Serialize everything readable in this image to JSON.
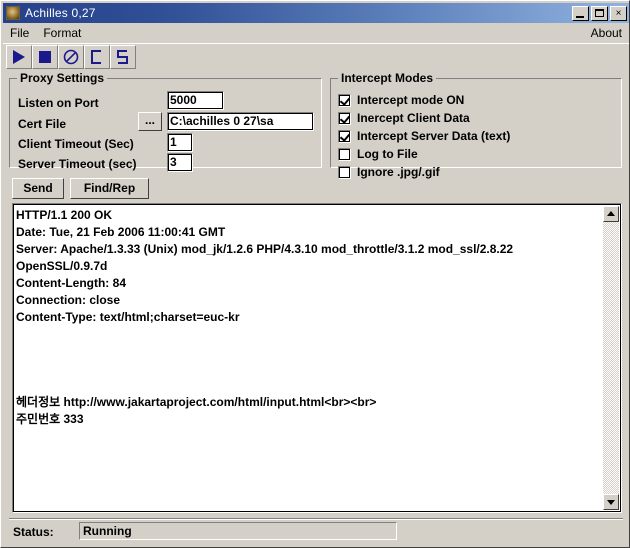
{
  "window": {
    "title": "Achilles 0,27",
    "icon": "achilles-app-icon",
    "controls": {
      "minimize": "minimize-icon",
      "maximize": "maximize-icon",
      "close": "×"
    }
  },
  "menu": {
    "items": [
      {
        "label": "File"
      },
      {
        "label": "Format"
      }
    ],
    "right_items": [
      {
        "label": "About"
      }
    ]
  },
  "toolbar": {
    "buttons": [
      {
        "name": "start-proxy-button",
        "icon": "play-triangle-icon"
      },
      {
        "name": "stop-proxy-button",
        "icon": "stop-square-icon"
      },
      {
        "name": "block-button",
        "icon": "circle-slash-icon"
      },
      {
        "name": "client-data-button",
        "icon": "letter-c-icon"
      },
      {
        "name": "server-data-button",
        "icon": "letter-s-icon"
      }
    ]
  },
  "proxy_settings": {
    "title": "Proxy Settings",
    "listen_port": {
      "label": "Listen on Port",
      "value": "5000"
    },
    "cert_file": {
      "label": "Cert File",
      "value": "C:\\achilles 0 27\\sa",
      "browse_label": "..."
    },
    "client_timeout": {
      "label": "Client Timeout (Sec)",
      "value": "1"
    },
    "server_timeout": {
      "label": "Server Timeout (sec)",
      "value": "3"
    }
  },
  "intercept_modes": {
    "title": "Intercept Modes",
    "options": [
      {
        "label": "Intercept mode ON",
        "checked": true
      },
      {
        "label": "Inercept Client Data",
        "checked": true
      },
      {
        "label": "Intercept Server Data (text)",
        "checked": true
      },
      {
        "label": "Log to File",
        "checked": false
      },
      {
        "label": "Ignore .jpg/.gif",
        "checked": false
      }
    ]
  },
  "actions": {
    "send_label": "Send",
    "find_rep_label": "Find/Rep"
  },
  "text_area": {
    "lines": [
      "HTTP/1.1 200 OK",
      "Date: Tue, 21 Feb 2006 11:00:41 GMT",
      "Server: Apache/1.3.33 (Unix) mod_jk/1.2.6 PHP/4.3.10 mod_throttle/3.1.2 mod_ssl/2.8.22",
      "OpenSSL/0.9.7d",
      "Content-Length: 84",
      "Connection: close",
      "Content-Type: text/html;charset=euc-kr",
      "",
      "",
      "",
      "",
      "헤더정보 http://www.jakartaproject.com/html/input.html<br><br>",
      "주민번호 333"
    ],
    "scrollbar": {
      "up_arrow": "scroll-up-icon",
      "down_arrow": "scroll-down-icon"
    }
  },
  "status_bar": {
    "label": "Status:",
    "value": "Running"
  },
  "colors": {
    "face": "#d4d0c8",
    "title_gradient_start": "#27408b",
    "title_gradient_end": "#92b3e0",
    "toolbar_icon": "#1a1a8c",
    "text": "#000000"
  }
}
